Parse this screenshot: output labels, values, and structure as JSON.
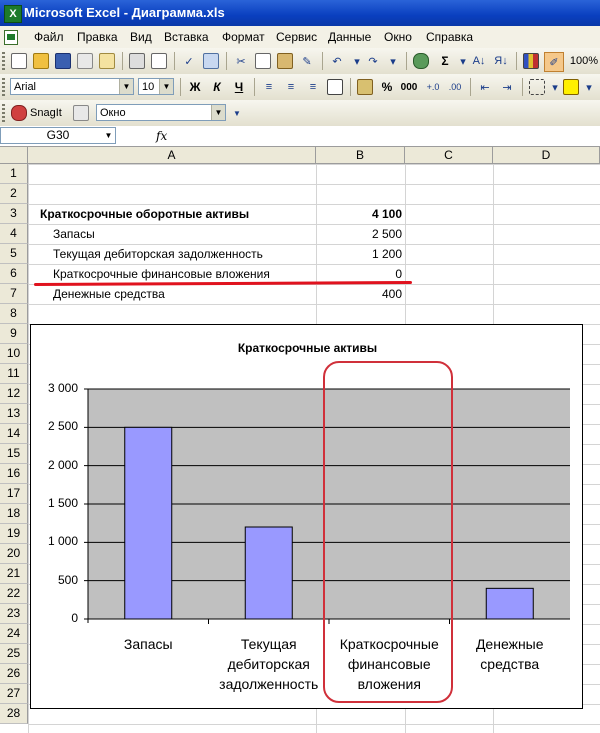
{
  "window": {
    "title": "Microsoft Excel - Диаграмма.xls",
    "app_icon": "X"
  },
  "menubar": {
    "items": [
      {
        "label": "Файл",
        "ul": "Ф"
      },
      {
        "label": "Правка",
        "ul": "П"
      },
      {
        "label": "Вид",
        "ul": "В"
      },
      {
        "label": "Вставка",
        "ul": "а"
      },
      {
        "label": "Формат",
        "ul": "Ф"
      },
      {
        "label": "Сервис",
        "ul": "С"
      },
      {
        "label": "Данные",
        "ul": "Д"
      },
      {
        "label": "Окно",
        "ul": "О"
      },
      {
        "label": "Справка",
        "ul": "С"
      }
    ]
  },
  "toolbar_standard": {
    "sigma": "Σ",
    "zoom": "100%"
  },
  "toolbar_format": {
    "font": "Arial",
    "size": "10",
    "bold": "Ж",
    "italic": "К",
    "underline": "Ч",
    "percent": "%",
    "thousands": "000"
  },
  "toolbar_snagit": {
    "snagit_label": "SnagIt",
    "mode_value": "Окно"
  },
  "formula_bar": {
    "name_box": "G30",
    "fx": "fx",
    "content": ""
  },
  "grid": {
    "columns": [
      "A",
      "B",
      "C",
      "D"
    ],
    "rows": [
      "1",
      "2",
      "3",
      "4",
      "5",
      "6",
      "7",
      "8",
      "9",
      "10",
      "11",
      "12",
      "13",
      "14",
      "15",
      "16",
      "17",
      "18",
      "19",
      "20",
      "21",
      "22",
      "23",
      "24",
      "25",
      "26",
      "27",
      "28"
    ],
    "data_rows": [
      {
        "row": 3,
        "label": "Краткосрочные оборотные активы",
        "value": "4 100",
        "bold": true,
        "indent": false
      },
      {
        "row": 4,
        "label": "Запасы",
        "value": "2 500",
        "bold": false,
        "indent": true
      },
      {
        "row": 5,
        "label": "Текущая дебиторская задолженность",
        "value": "1 200",
        "bold": false,
        "indent": true
      },
      {
        "row": 6,
        "label": "Краткосрочные финансовые вложения",
        "value": "0",
        "bold": false,
        "indent": true
      },
      {
        "row": 7,
        "label": "Денежные средства",
        "value": "400",
        "bold": false,
        "indent": true
      }
    ]
  },
  "colors": {
    "bar_fill": "#9999ff",
    "plot_bg": "#c0c0c0",
    "highlight": "#d0303a",
    "underline_mark": "#e0121e"
  },
  "chart_data": {
    "type": "bar",
    "title": "Краткосрочные активы",
    "categories": [
      "Запасы",
      "Текущая дебиторская задолженность",
      "Краткосрочные финансовые вложения",
      "Денежные средства"
    ],
    "category_lines": [
      [
        "Запасы"
      ],
      [
        "Текущая",
        "дебиторская",
        "задолженность"
      ],
      [
        "Краткосрочные",
        "финансовые",
        "вложения"
      ],
      [
        "Денежные",
        "средства"
      ]
    ],
    "values": [
      2500,
      1200,
      0,
      400
    ],
    "ylim": [
      0,
      3000
    ],
    "yticks": [
      0,
      500,
      1000,
      1500,
      2000,
      2500,
      3000
    ],
    "ytick_labels": [
      "0",
      "500",
      "1 000",
      "1 500",
      "2 000",
      "2 500",
      "3 000"
    ],
    "grid": true,
    "legend": "none",
    "highlighted_category": "Краткосрочные финансовые вложения"
  }
}
